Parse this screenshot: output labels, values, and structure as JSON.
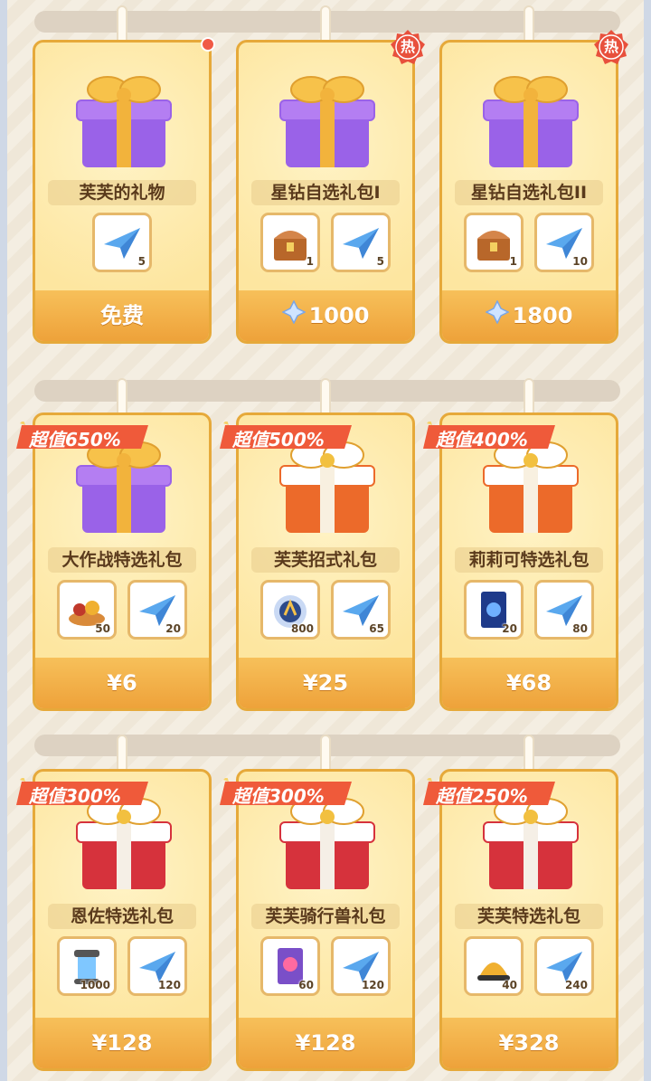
{
  "colors": {
    "accent": "#e6a93a",
    "hot": "#e8503c",
    "badge": "#f05a3a",
    "price_bg": "#f0a83c"
  },
  "cards": [
    {
      "title": "芙芙的礼物",
      "gift": "purple-gift",
      "price": "免费",
      "price_type": "text",
      "tag": "red-dot",
      "items": [
        {
          "icon": "paper-plane-icon",
          "qty": "5"
        }
      ]
    },
    {
      "title": "星钻自选礼包I",
      "gift": "purple-gift",
      "price": "1000",
      "price_type": "diamond",
      "tag": "hot",
      "hot_label": "热",
      "items": [
        {
          "icon": "treasure-chest-icon",
          "qty": "1"
        },
        {
          "icon": "paper-plane-icon",
          "qty": "5"
        }
      ]
    },
    {
      "title": "星钻自选礼包II",
      "gift": "purple-gift",
      "price": "1800",
      "price_type": "diamond",
      "tag": "hot",
      "hot_label": "热",
      "items": [
        {
          "icon": "treasure-chest-icon",
          "qty": "1"
        },
        {
          "icon": "paper-plane-icon",
          "qty": "10"
        }
      ]
    },
    {
      "title": "大作战特选礼包",
      "gift": "purple-gift",
      "price": "¥6",
      "price_type": "text",
      "tag": "badge",
      "badge": "超值650%",
      "items": [
        {
          "icon": "food-platter-icon",
          "qty": "50"
        },
        {
          "icon": "paper-plane-icon",
          "qty": "20"
        }
      ]
    },
    {
      "title": "芙芙招式礼包",
      "gift": "orange-gift",
      "price": "¥25",
      "price_type": "text",
      "tag": "badge",
      "badge": "超值500%",
      "items": [
        {
          "icon": "crystal-orb-icon",
          "qty": "800"
        },
        {
          "icon": "paper-plane-icon",
          "qty": "65"
        }
      ]
    },
    {
      "title": "莉莉可特选礼包",
      "gift": "orange-gift",
      "price": "¥68",
      "price_type": "text",
      "tag": "badge",
      "badge": "超值400%",
      "items": [
        {
          "icon": "card-icon",
          "qty": "20"
        },
        {
          "icon": "paper-plane-icon",
          "qty": "80"
        }
      ]
    },
    {
      "title": "恩佐特选礼包",
      "gift": "red-gift",
      "price": "¥128",
      "price_type": "text",
      "tag": "badge",
      "badge": "超值300%",
      "items": [
        {
          "icon": "gear-canister-icon",
          "qty": "1000"
        },
        {
          "icon": "paper-plane-icon",
          "qty": "120"
        }
      ]
    },
    {
      "title": "芙芙骑行兽礼包",
      "gift": "red-gift",
      "price": "¥128",
      "price_type": "text",
      "tag": "badge",
      "badge": "超值300%",
      "items": [
        {
          "icon": "mount-card-icon",
          "qty": "60"
        },
        {
          "icon": "paper-plane-icon",
          "qty": "120"
        }
      ]
    },
    {
      "title": "芙芙特选礼包",
      "gift": "red-gift",
      "price": "¥328",
      "price_type": "text",
      "tag": "badge",
      "badge": "超值250%",
      "items": [
        {
          "icon": "bell-hat-icon",
          "qty": "40"
        },
        {
          "icon": "paper-plane-icon",
          "qty": "240"
        }
      ]
    }
  ]
}
